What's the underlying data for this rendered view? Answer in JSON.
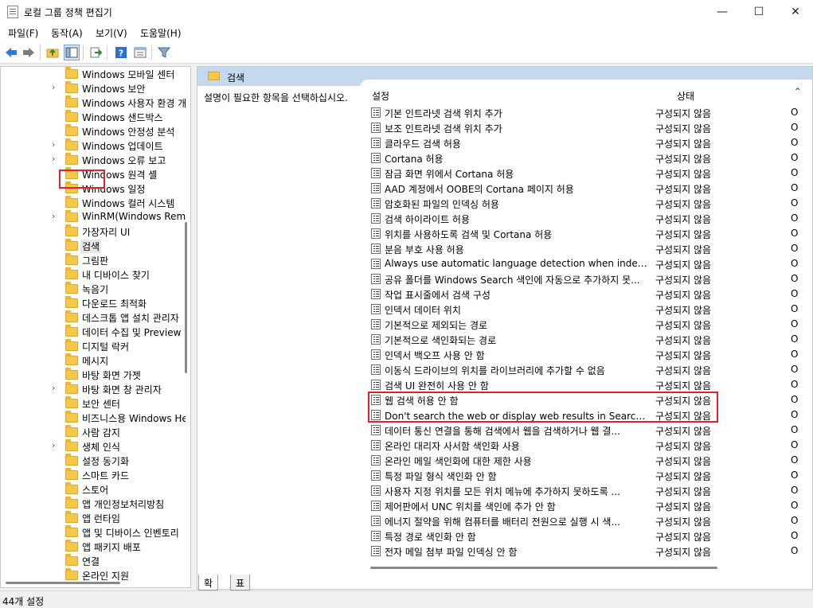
{
  "window": {
    "title": "로컬 그룹 정책 편집기",
    "minimize": "—",
    "maximize": "☐",
    "close": "✕"
  },
  "menu": [
    "파일(F)",
    "동작(A)",
    "보기(V)",
    "도움말(H)"
  ],
  "tree": {
    "items": [
      {
        "label": "Windows 모바일 센터",
        "expand": false
      },
      {
        "label": "Windows 보안",
        "expand": true
      },
      {
        "label": "Windows 사용자 환경 개",
        "expand": false
      },
      {
        "label": "Windows 샌드박스",
        "expand": false
      },
      {
        "label": "Windows 안정성 분석",
        "expand": false
      },
      {
        "label": "Windows 업데이트",
        "expand": true
      },
      {
        "label": "Windows 오류 보고",
        "expand": true
      },
      {
        "label": "Windows 원격 셸",
        "expand": false
      },
      {
        "label": "Windows 일정",
        "expand": false
      },
      {
        "label": "Windows 컬러 시스템",
        "expand": false
      },
      {
        "label": "WinRM(Windows Remote",
        "expand": true
      },
      {
        "label": "가장자리 UI",
        "expand": false
      },
      {
        "label": "검색",
        "expand": false,
        "selected": true
      },
      {
        "label": "그림판",
        "expand": false
      },
      {
        "label": "내 디바이스 찾기",
        "expand": false
      },
      {
        "label": "녹음기",
        "expand": false
      },
      {
        "label": "다운로드 최적화",
        "expand": false
      },
      {
        "label": "데스크톱 앱 설치 관리자",
        "expand": false
      },
      {
        "label": "데이터 수집 및 Preview 빌",
        "expand": false
      },
      {
        "label": "디지털 락커",
        "expand": false
      },
      {
        "label": "메시지",
        "expand": false
      },
      {
        "label": "바탕 화면 가젯",
        "expand": false
      },
      {
        "label": "바탕 화면 창 관리자",
        "expand": true
      },
      {
        "label": "보안 센터",
        "expand": false
      },
      {
        "label": "비즈니스용 Windows Hel",
        "expand": false
      },
      {
        "label": "사람 감지",
        "expand": false
      },
      {
        "label": "생체 인식",
        "expand": true
      },
      {
        "label": "설정 동기화",
        "expand": false
      },
      {
        "label": "스마트 카드",
        "expand": false
      },
      {
        "label": "스토어",
        "expand": false
      },
      {
        "label": "앱 개인정보처리방침",
        "expand": false
      },
      {
        "label": "앱 런타임",
        "expand": false
      },
      {
        "label": "앱 및 디바이스 인벤토리",
        "expand": false
      },
      {
        "label": "앱 패키지 배포",
        "expand": false
      },
      {
        "label": "연결",
        "expand": false
      },
      {
        "label": "온라인 지원",
        "expand": false
      }
    ]
  },
  "right": {
    "header": "검색",
    "description": "설명이 필요한 항목을 선택하십시오.",
    "columns": {
      "name": "설정",
      "state": "상태",
      "extra": "^"
    },
    "rows": [
      {
        "name": "기본 인트라넷 검색 위치 추가",
        "state": "구성되지 않음",
        "extra": "O"
      },
      {
        "name": "보조 인트라넷 검색 위치 추가",
        "state": "구성되지 않음",
        "extra": "O"
      },
      {
        "name": "클라우드 검색 허용",
        "state": "구성되지 않음",
        "extra": "O"
      },
      {
        "name": "Cortana 허용",
        "state": "구성되지 않음",
        "extra": "O"
      },
      {
        "name": "잠금 화면 위에서 Cortana 허용",
        "state": "구성되지 않음",
        "extra": "O"
      },
      {
        "name": "AAD 계정에서 OOBE의 Cortana 페이지 허용",
        "state": "구성되지 않음",
        "extra": "O"
      },
      {
        "name": "암호화된 파일의 인덱싱 허용",
        "state": "구성되지 않음",
        "extra": "O"
      },
      {
        "name": "검색 하이라이트 허용",
        "state": "구성되지 않음",
        "extra": "O"
      },
      {
        "name": "위치를 사용하도록 검색 및 Cortana 허용",
        "state": "구성되지 않음",
        "extra": "O"
      },
      {
        "name": "분음 부호 사용 허용",
        "state": "구성되지 않음",
        "extra": "O"
      },
      {
        "name": "Always use automatic language detection when indexing c...",
        "state": "구성되지 않음",
        "extra": "O"
      },
      {
        "name": "공유 폴더를 Windows Search 색인에 자동으로 추가하지 못...",
        "state": "구성되지 않음",
        "extra": "O"
      },
      {
        "name": "작업 표시줄에서 검색 구성",
        "state": "구성되지 않음",
        "extra": "O"
      },
      {
        "name": "인덱서 데이터 위치",
        "state": "구성되지 않음",
        "extra": "O"
      },
      {
        "name": "기본적으로 제외되는 경로",
        "state": "구성되지 않음",
        "extra": "O"
      },
      {
        "name": "기본적으로 색인화되는 경로",
        "state": "구성되지 않음",
        "extra": "O"
      },
      {
        "name": "인덱서 백오프 사용 안 함",
        "state": "구성되지 않음",
        "extra": "O"
      },
      {
        "name": "이동식 드라이브의 위치를 라이브러리에 추가할 수 없음",
        "state": "구성되지 않음",
        "extra": "O"
      },
      {
        "name": "검색 UI 완전히 사용 안 함",
        "state": "구성되지 않음",
        "extra": "O"
      },
      {
        "name": "웹 검색 허용 안 함",
        "state": "구성되지 않음",
        "extra": "O"
      },
      {
        "name": "Don't search the web or display web results in Search(검색...",
        "state": "구성되지 않음",
        "extra": "O"
      },
      {
        "name": "데이터 통신 연결을 통해 검색에서 웹을 검색하거나 웹 결...",
        "state": "구성되지 않음",
        "extra": "O"
      },
      {
        "name": "온라인 대리자 사서함 색인화 사용",
        "state": "구성되지 않음",
        "extra": "O"
      },
      {
        "name": "온라인 메일 색인화에 대한 제한 사용",
        "state": "구성되지 않음",
        "extra": "O"
      },
      {
        "name": "특정 파일 형식 색인화 안 함",
        "state": "구성되지 않음",
        "extra": "O"
      },
      {
        "name": "사용자 지정 위치를 모든 위치 메뉴에 추가하지 못하도록 ...",
        "state": "구성되지 않음",
        "extra": "O"
      },
      {
        "name": "제어판에서 UNC 위치를 색인에 추가 안 함",
        "state": "구성되지 않음",
        "extra": "O"
      },
      {
        "name": "에너지 절약을 위해 컴퓨터를 배터리 전원으로 실행 시 색...",
        "state": "구성되지 않음",
        "extra": "O"
      },
      {
        "name": "특정 경로 색인화 안 함",
        "state": "구성되지 않음",
        "extra": "O"
      },
      {
        "name": "전자 메일 첨부 파일 인덱싱 안 함",
        "state": "구성되지 않음",
        "extra": "O"
      }
    ]
  },
  "tabs": [
    "확장",
    "표준"
  ],
  "status": "44개 설정",
  "colors": {
    "header_bg": "#c5d9ee",
    "highlight": "#e0202a",
    "folder": "#f5c84a"
  }
}
